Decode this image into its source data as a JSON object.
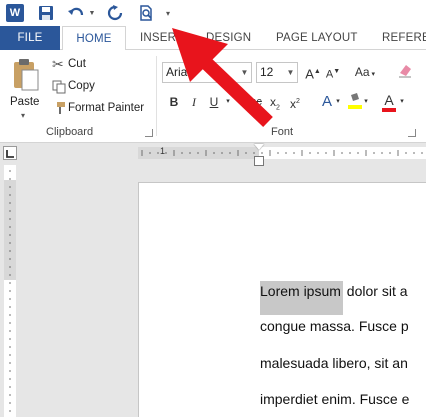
{
  "qat": {
    "logo": "W",
    "icons": [
      "word-logo",
      "save-icon",
      "undo-icon",
      "redo-icon",
      "print-preview-icon",
      "customize-qat-icon"
    ]
  },
  "tabs": {
    "file": "FILE",
    "home": "HOME",
    "insert": "INSERT",
    "design": "DESIGN",
    "page_layout": "PAGE LAYOUT",
    "references": "REFEREN"
  },
  "clipboard": {
    "paste": "Paste",
    "cut": "Cut",
    "copy": "Copy",
    "format_painter": "Format Painter",
    "label": "Clipboard"
  },
  "font": {
    "name": "Aria",
    "size": "12",
    "grow": "A",
    "shrink": "A",
    "change_case": "Aa",
    "bold": "B",
    "italic": "I",
    "underline": "U",
    "strikethrough": "abc",
    "subscript": "x",
    "superscript": "x",
    "text_effects": "A",
    "font_color": "A",
    "label": "Font"
  },
  "ruler": {
    "h_label": "1"
  },
  "document": {
    "lines": [
      {
        "highlight": "Lorem ipsum",
        "rest": " dolor sit a"
      },
      {
        "highlight": "",
        "rest": "congue massa. Fusce p"
      },
      {
        "highlight": "",
        "rest": "malesuada libero, sit an"
      },
      {
        "highlight": "",
        "rest": "imperdiet enim. Fusce e"
      }
    ]
  },
  "colors": {
    "word_blue": "#2b579a",
    "arrow_red": "#e8141c",
    "highlight_gray": "#c8c8c8",
    "font_color_red": "#e8141c",
    "highlighter_yellow": "#ffff00"
  }
}
